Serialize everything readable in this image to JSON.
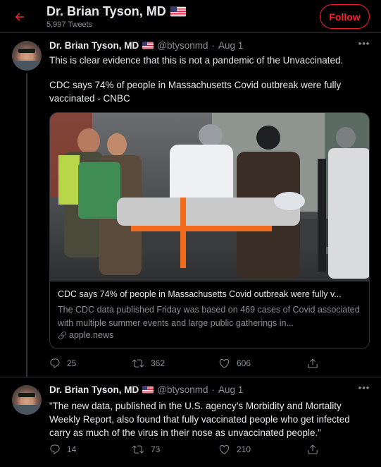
{
  "header": {
    "title": "Dr. Brian Tyson, MD",
    "tweet_count": "5,997 Tweets",
    "follow_label": "Follow"
  },
  "colors": {
    "background": "#000000",
    "accent_red": "#f4212e",
    "muted_text": "#8b8f93",
    "divider": "#2f3336"
  },
  "icons": {
    "back": "back-arrow-icon",
    "flag": "us-flag-icon",
    "more": "more-icon",
    "reply": "reply-icon",
    "retweet": "retweet-icon",
    "like": "like-icon",
    "share": "share-icon",
    "link": "link-icon"
  },
  "tweets": [
    {
      "name": "Dr. Brian Tyson, MD",
      "handle": "@btysonmd",
      "date": "Aug 1",
      "text_line1": "This is clear evidence that this is not a pandemic of the Unvaccinated.",
      "text_line2": "CDC says 74% of people in Massachusetts Covid outbreak were fully vaccinated - CNBC",
      "card": {
        "title": "CDC says 74% of people in Massachusetts Covid outbreak were fully v...",
        "description": "The CDC data published Friday was based on 469 cases of Covid associated with multiple summer events and large public gatherings in...",
        "domain": "apple.news"
      },
      "stats": {
        "replies": "25",
        "retweets": "362",
        "likes": "606"
      }
    },
    {
      "name": "Dr. Brian Tyson, MD",
      "handle": "@btysonmd",
      "date": "Aug 1",
      "text": "“The new data, published in the U.S. agency’s Morbidity and Mortality Weekly Report, also found that fully vaccinated people who get infected carry as much of the virus in their nose as unvaccinated people.”",
      "stats": {
        "replies": "14",
        "retweets": "73",
        "likes": "210"
      }
    }
  ]
}
